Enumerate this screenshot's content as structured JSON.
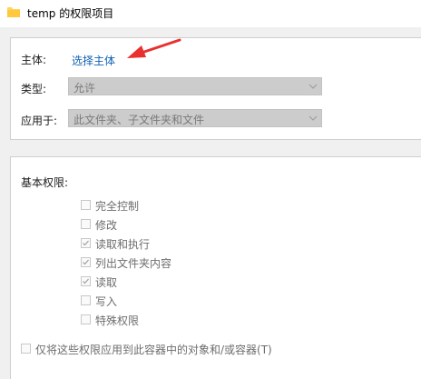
{
  "window": {
    "title": "temp 的权限项目"
  },
  "principal": {
    "label": "主体:",
    "link_text": "选择主体"
  },
  "type": {
    "label": "类型:",
    "value": "允许"
  },
  "applies_to": {
    "label": "应用于:",
    "value": "此文件夹、子文件夹和文件"
  },
  "basic_permissions": {
    "label": "基本权限:",
    "items": [
      {
        "label": "完全控制",
        "checked": false
      },
      {
        "label": "修改",
        "checked": false
      },
      {
        "label": "读取和执行",
        "checked": true
      },
      {
        "label": "列出文件夹内容",
        "checked": true
      },
      {
        "label": "读取",
        "checked": true
      },
      {
        "label": "写入",
        "checked": false
      },
      {
        "label": "特殊权限",
        "checked": false
      }
    ]
  },
  "apply_to_containers": {
    "label": "仅将这些权限应用到此容器中的对象和/或容器(T)",
    "checked": false
  },
  "colors": {
    "link": "#0f61b3",
    "annotation_arrow": "#e8312f",
    "disabled_combo": "#cccccc"
  }
}
